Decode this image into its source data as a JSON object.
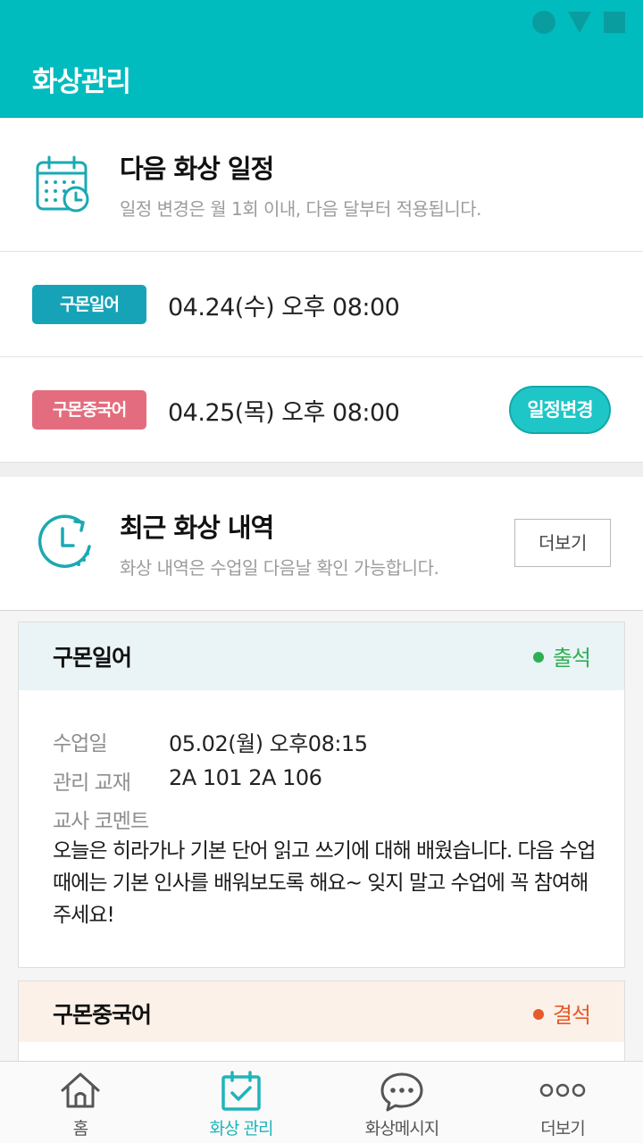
{
  "colors": {
    "header": "#00bcbf",
    "accent": "#1fc6c7",
    "tag_japanese": "#16a3b8",
    "tag_chinese": "#e36d7e",
    "attend": "#2fae54",
    "absent": "#e85a2a"
  },
  "header": {
    "title": "화상관리"
  },
  "schedule": {
    "title": "다음 화상 일정",
    "subtitle": "일정 변경은 월 1회 이내, 다음 달부터 적용됩니다.",
    "icon": "calendar-icon",
    "items": [
      {
        "tag": "구몬일어",
        "datetime": "04.24(수) 오후 08:00"
      },
      {
        "tag": "구몬중국어",
        "datetime": "04.25(목) 오후 08:00",
        "action": "일정변경"
      }
    ]
  },
  "history": {
    "title": "최근 화상 내역",
    "subtitle": "화상 내역은 수업일 다음날 확인 가능합니다.",
    "icon": "clock-history-icon",
    "more_label": "더보기",
    "cards": [
      {
        "subject": "구몬일어",
        "status": "출석",
        "class_date_label": "수업일",
        "class_date": "05.02(월) 오후08:15",
        "material_label": "관리 교재",
        "material": "2A 101 2A 106",
        "comment_label": "교사 코멘트",
        "comment": "오늘은 히라가나 기본 단어 읽고 쓰기에 대해 배웠습니다. 다음 수업 때에는 기본 인사를 배워보도록 해요~ 잊지 말고 수업에 꼭 참여해 주세요!"
      },
      {
        "subject": "구몬중국어",
        "status": "결석"
      }
    ]
  },
  "nav": {
    "items": [
      {
        "label": "홈",
        "icon": "home-icon"
      },
      {
        "label": "화상 관리",
        "icon": "calendar-check-icon",
        "active": true
      },
      {
        "label": "화상메시지",
        "icon": "chat-bubble-icon"
      },
      {
        "label": "더보기",
        "icon": "more-dots-icon"
      }
    ]
  }
}
